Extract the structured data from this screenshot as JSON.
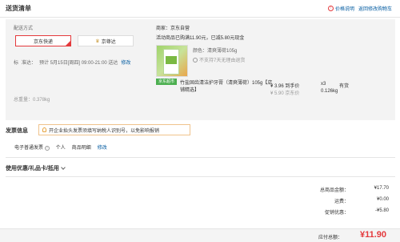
{
  "header": {
    "title": "送货清单",
    "price_note": "价格说明",
    "back_cart": "返回修改购物车"
  },
  "shipping": {
    "label": "配送方式",
    "option_selected": "京东快递",
    "option_alt": "京尊达",
    "time_label": "标",
    "time_prefix": "准达：",
    "time_value": "预计 5月15日[周四] 09:00-21:00 送达",
    "modify": "修改",
    "weight_label": "总重量：",
    "weight_value": "0.378kg"
  },
  "seller": {
    "name": "商家：京东自营",
    "promo": "活动商品已购满11.90元，已减5.80元现金"
  },
  "product": {
    "tag": "京东超市",
    "color": "颜色：清爽薄荷105g",
    "no_return": "不支持7天无理由退货",
    "name": "竹盐固齿清洁护牙膏（清爽薄荷）105g【店铺精选】",
    "price": "¥ 3.96 到手价",
    "price_sub": "¥ 5.90 京东价",
    "qty": "x3",
    "stock": "有货",
    "weight": "0.126kg"
  },
  "invoice": {
    "title": "发票信息",
    "tip": "开企业抬头发票须填写纳税人识别号，以免影响报销",
    "type": "电子普通发票",
    "type_help": "?",
    "title_type": "个人",
    "content": "商品明细",
    "modify": "修改"
  },
  "coupon": {
    "title": "使用优惠/礼品卡/抵用"
  },
  "summary": {
    "rows": [
      {
        "label": "总商品金额：",
        "value": "¥17.70"
      },
      {
        "label": "运费：",
        "value": "¥0.00"
      },
      {
        "label": "促销优惠：",
        "value": "-¥5.80"
      }
    ],
    "total_label": "应付总额：",
    "total_value": "¥11.90"
  },
  "colors": {
    "accent": "#e4393c",
    "link": "#005aa0",
    "panel": "#f3f3f3"
  },
  "icons": {
    "price_note": "info-icon",
    "no_return": "info-icon",
    "invoice_tip": "lightbulb-icon",
    "coupon": "chevron-down-icon",
    "ship_alt": "crown-icon"
  }
}
